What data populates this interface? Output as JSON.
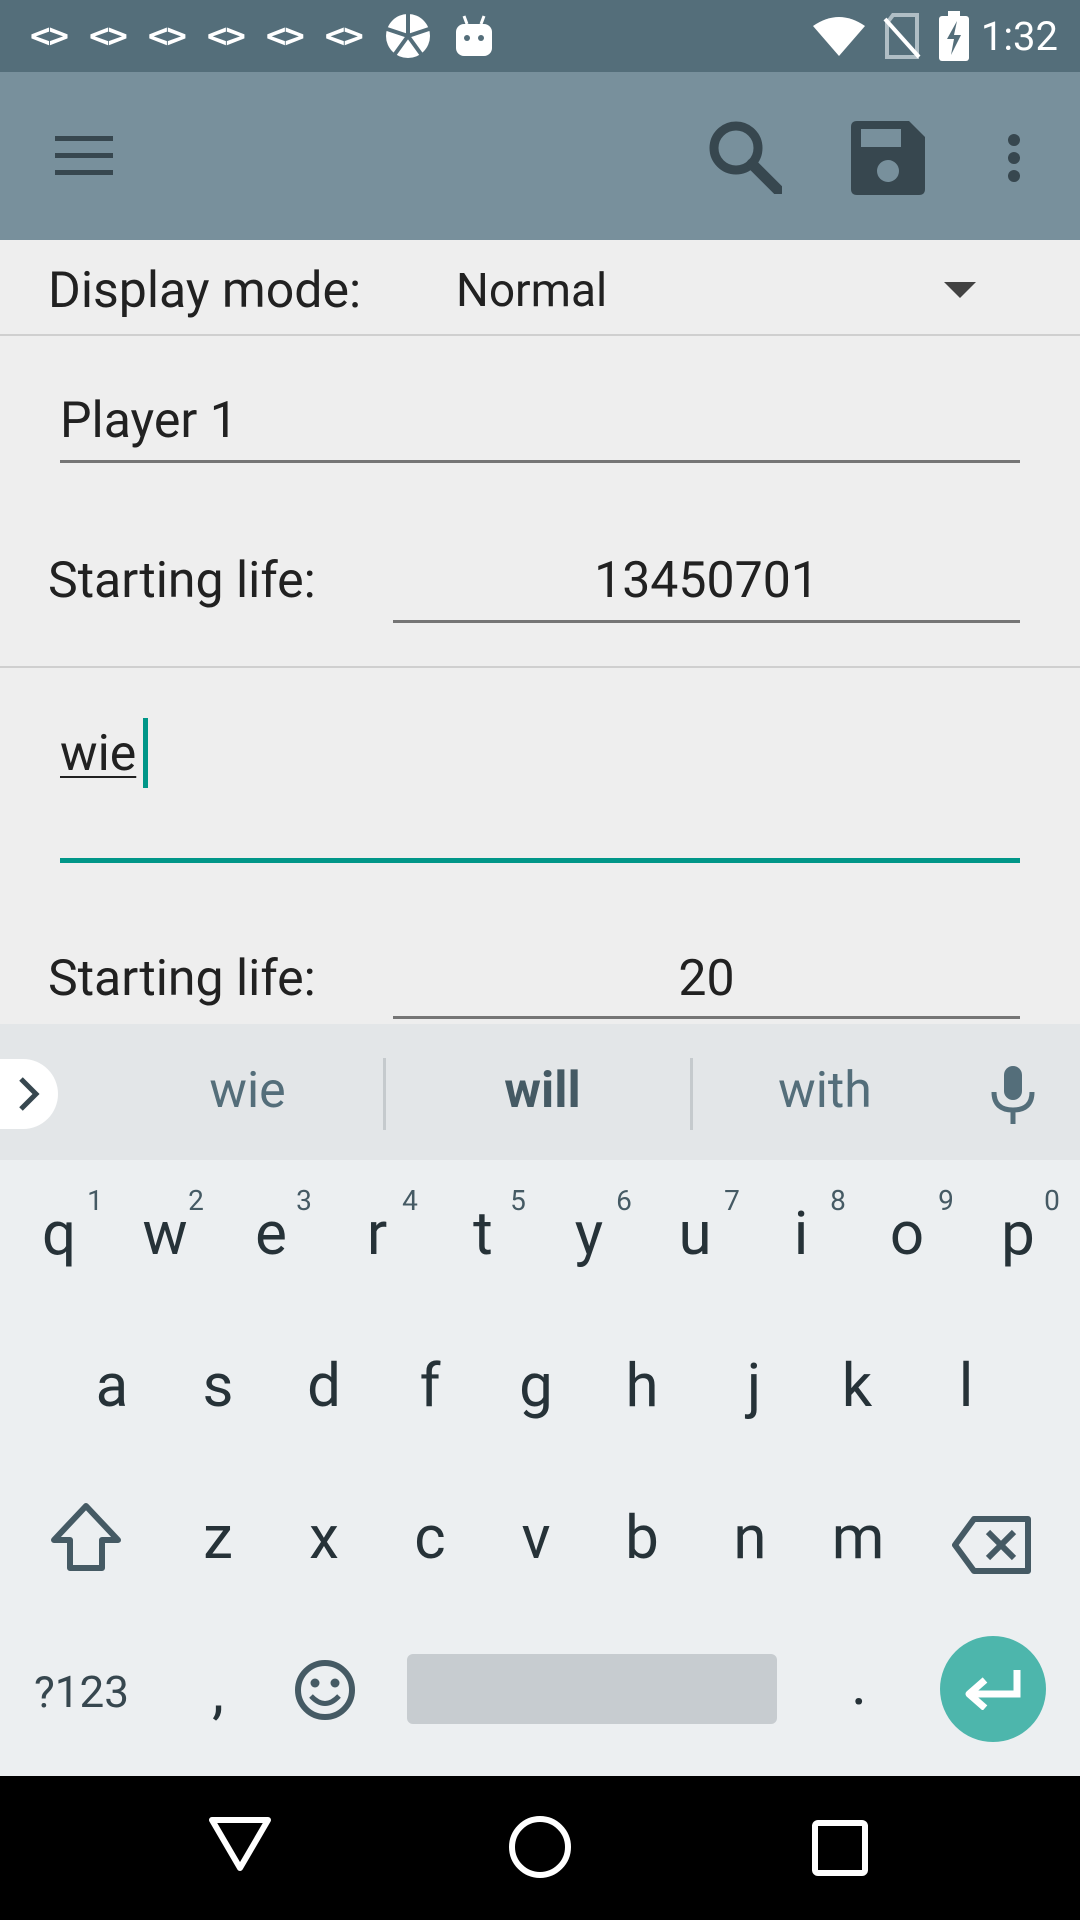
{
  "status_bar": {
    "notification_icons": [
      "<>",
      "<>",
      "<>",
      "<>",
      "<>",
      "<>"
    ],
    "time": "1:32",
    "icons": [
      "app-badge-icon",
      "android-icon",
      "wifi-icon",
      "no-sim-icon",
      "battery-charging-icon"
    ]
  },
  "toolbar": {
    "icons": [
      "menu-icon",
      "search-icon",
      "save-icon",
      "more-vert-icon"
    ],
    "background": "#78909c"
  },
  "display_mode": {
    "label": "Display mode:",
    "value": "Normal"
  },
  "player1": {
    "name_value": "Player 1",
    "life_label": "Starting life:",
    "life_value": "13450701"
  },
  "player2": {
    "name_value": "wie",
    "life_label": "Starting life:",
    "life_value": "20"
  },
  "keyboard": {
    "suggestions": [
      "wie",
      "will",
      "with"
    ],
    "row1": [
      "q",
      "w",
      "e",
      "r",
      "t",
      "y",
      "u",
      "i",
      "o",
      "p"
    ],
    "row1_hints": [
      "1",
      "2",
      "3",
      "4",
      "5",
      "6",
      "7",
      "8",
      "9",
      "0"
    ],
    "row2": [
      "a",
      "s",
      "d",
      "f",
      "g",
      "h",
      "j",
      "k",
      "l"
    ],
    "row3": [
      "z",
      "x",
      "c",
      "v",
      "b",
      "n",
      "m"
    ],
    "symbols_label": "?123",
    "comma": ",",
    "period": ".",
    "accent": "#4db6ac"
  },
  "nav": {
    "icons": [
      "back-icon",
      "home-icon",
      "recents-icon"
    ]
  }
}
